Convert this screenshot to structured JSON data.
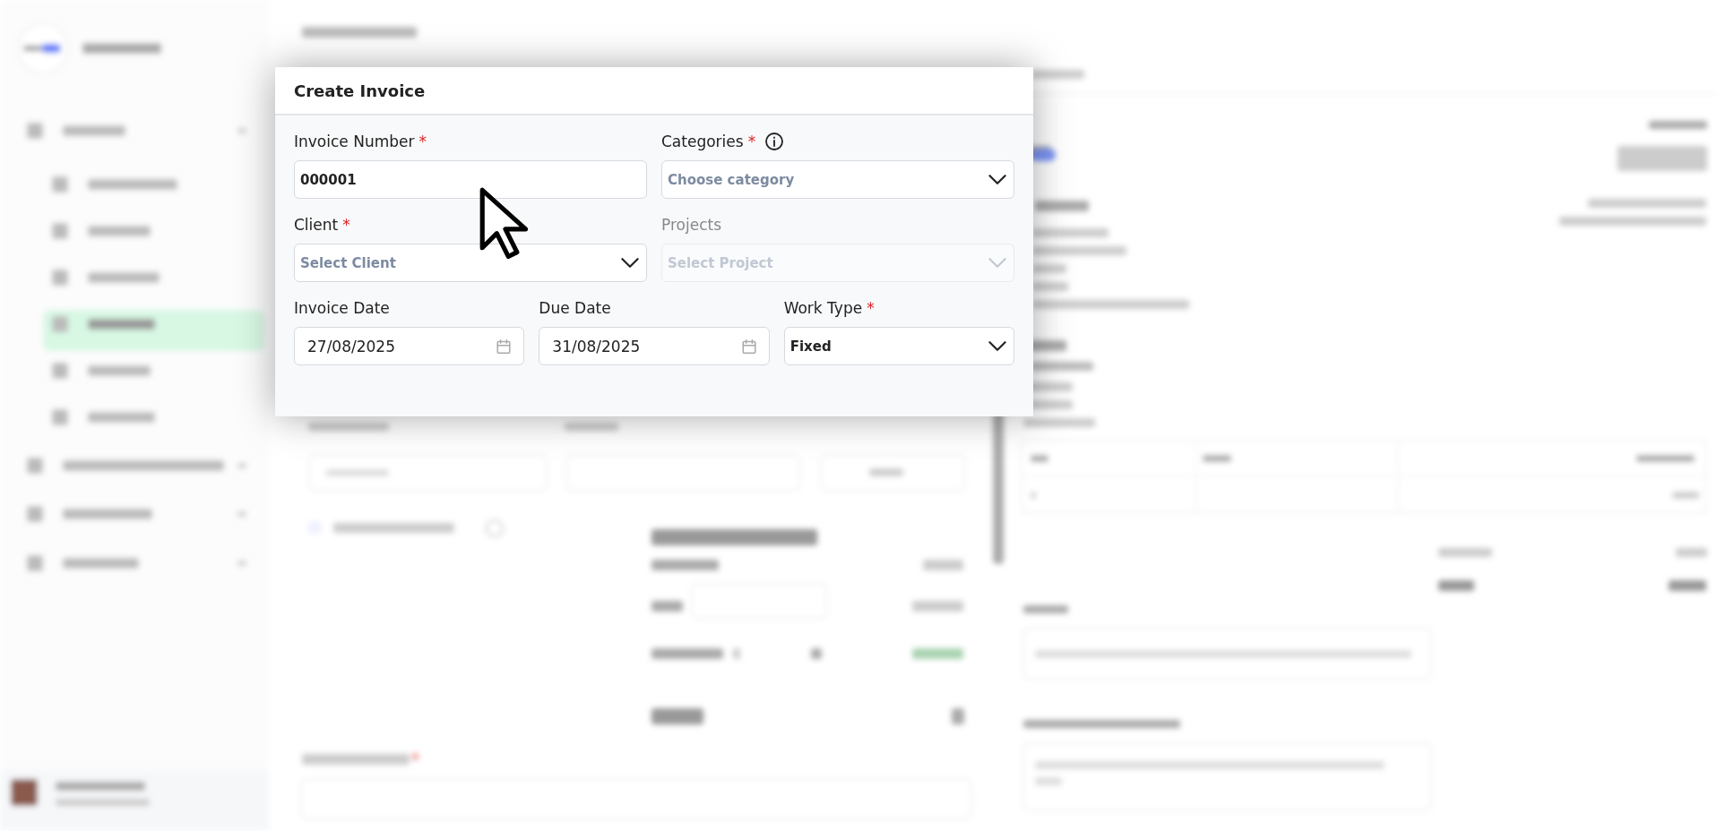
{
  "modal": {
    "title": "Create Invoice",
    "rows": [
      [
        {
          "label": "Invoice Number",
          "asterisk": "*",
          "kind": "text",
          "value": "000001",
          "disabled": false
        },
        {
          "label": "Categories",
          "asterisk": "*",
          "info": true,
          "kind": "select",
          "placeholder": "Choose category",
          "disabled": false
        }
      ],
      [
        {
          "label": "Client",
          "asterisk": "*",
          "kind": "select",
          "placeholder": "Select Client",
          "disabled": false
        },
        {
          "label": "Projects",
          "kind": "select",
          "placeholder": "Select Project",
          "disabled": true
        }
      ],
      [
        {
          "label": "Invoice Date",
          "kind": "date",
          "value": "27/08/2025",
          "disabled": false
        },
        {
          "label": "Due Date",
          "kind": "date",
          "value": "31/08/2025",
          "disabled": false
        },
        {
          "label": "Work Type",
          "asterisk": "*",
          "kind": "select",
          "value": "Fixed",
          "disabled": false
        }
      ]
    ]
  }
}
